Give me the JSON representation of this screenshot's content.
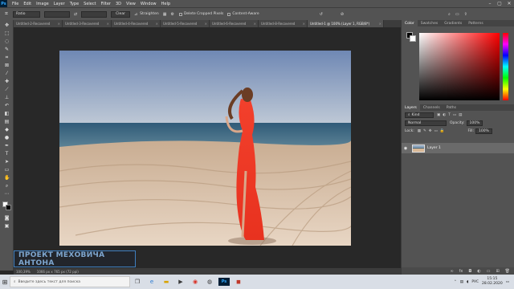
{
  "app": {
    "logo": "Ps"
  },
  "menu": [
    "File",
    "Edit",
    "Image",
    "Layer",
    "Type",
    "Select",
    "Filter",
    "3D",
    "View",
    "Window",
    "Help"
  ],
  "window_controls": {
    "minimize": "–",
    "maximize": "▢",
    "close": "✕"
  },
  "options": {
    "ratio_label": "Ratio",
    "clear_label": "Clear",
    "straighten_label": "Straighten",
    "delete_cropped_label": "Delete Cropped Pixels",
    "content_aware_label": "Content-Aware"
  },
  "tabs": [
    {
      "label": "Untitled-2-Recovered"
    },
    {
      "label": "Untitled-3-Recovered"
    },
    {
      "label": "Untitled-4-Recovered"
    },
    {
      "label": "Untitled-5-Recovered"
    },
    {
      "label": "Untitled-6-Recovered"
    },
    {
      "label": "Untitled-8-Recovered"
    },
    {
      "label": "Untitled-1 @ 100% (Layer 1, RGB/8*)"
    }
  ],
  "watermark": "ПРОЕКТ МЕХОВИЧА АНТОНА",
  "status": {
    "zoom": "100,39%",
    "doc_size": "1066 px x 765 px (72 ppi)"
  },
  "color_panel": {
    "tabs": [
      "Color",
      "Swatches",
      "Gradients",
      "Patterns"
    ]
  },
  "layers_panel": {
    "tabs": [
      "Layers",
      "Channels",
      "Paths"
    ],
    "kind_label": "Kind",
    "blend_mode": "Normal",
    "opacity_label": "Opacity:",
    "opacity_value": "100%",
    "lock_label": "Lock:",
    "fill_label": "Fill:",
    "fill_value": "100%",
    "layer_name": "Layer 1"
  },
  "taskbar": {
    "search_placeholder": "Введите здесь текст для поиска",
    "lang": "РУС",
    "time": "15:15",
    "date": "28.02.2020"
  },
  "colors": {
    "accent_blue": "#31a8ff",
    "ps_dark": "#001e36"
  }
}
